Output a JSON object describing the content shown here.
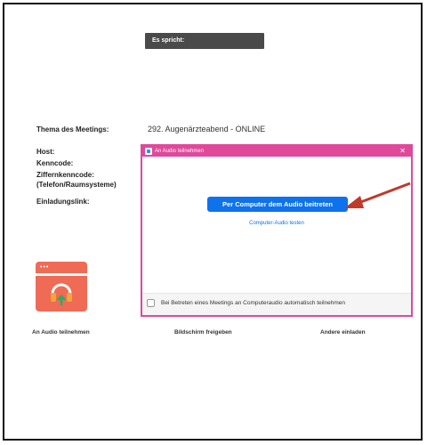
{
  "speaking": {
    "label": "Es spricht:"
  },
  "meeting_info": {
    "topic_label": "Thema des Meetings:",
    "topic_value": "292. Augenärzteabend - ONLINE",
    "host_label": "Host:",
    "passcode_label": "Kenncode:",
    "numeric_passcode_label_line1": "Ziffernkenncode:",
    "numeric_passcode_label_line2": "(Telefon/Raumsysteme)",
    "invite_link_label": "Einladungslink:"
  },
  "audio_dialog": {
    "title": "An Audio teilnehmen",
    "join_button": "Per Computer dem Audio beitreten",
    "test_link": "Computer-Audio testen",
    "auto_join_checkbox": "Bei Betreten eines Meetings an Computeraudio automatisch teilnehmen",
    "auto_join_checked": false,
    "accent_color": "#e0489a",
    "button_color": "#0e72ed"
  },
  "toolbar": {
    "join_audio": "An Audio teilnehmen",
    "share_screen": "Bildschirm freigeben",
    "invite_others": "Andere einladen",
    "tile_color": "#ef6b55"
  },
  "annotation": {
    "arrow_color": "#c0392b"
  }
}
